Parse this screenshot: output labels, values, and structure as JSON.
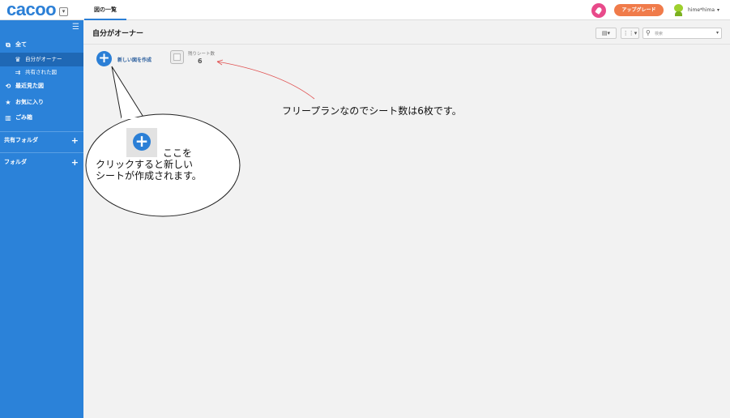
{
  "app": {
    "logo": "cacoo",
    "tab_label": "図の一覧",
    "upgrade_label": "アップグレード",
    "username": "hime*hima",
    "user_caret": "▾"
  },
  "sidebar": {
    "items": [
      {
        "label": "全て",
        "icon": "copy-icon",
        "glyph": "⧉"
      },
      {
        "label": "自分がオーナー",
        "icon": "crown-icon",
        "glyph": "♛"
      },
      {
        "label": "共有された図",
        "icon": "shared-user-icon",
        "glyph": "⇉"
      },
      {
        "label": "最近見た図",
        "icon": "history-icon",
        "glyph": "⟲"
      },
      {
        "label": "お気に入り",
        "icon": "star-icon",
        "glyph": "★"
      },
      {
        "label": "ごみ箱",
        "icon": "trash-icon",
        "glyph": "🗑"
      }
    ],
    "shared_folders_label": "共有フォルダ",
    "folders_label": "フォルダ"
  },
  "main": {
    "title": "自分がオーナー",
    "search_placeholder": "検索",
    "new_diagram_label": "新しい図を作成",
    "remaining_sheets_label": "残りシート数",
    "remaining_sheets_count": "6"
  },
  "annotation": {
    "note": "フリープランなのでシート数は6枚です。",
    "bubble_line1": "ここを",
    "bubble_line2": "クリックすると新しい",
    "bubble_line3": "シートが作成されます。"
  },
  "colors": {
    "sidebar": "#2b82d9",
    "accent": "#2b7fd6",
    "upgrade": "#f07b4a",
    "rocket": "#e84a8a",
    "arrow": "#e05050"
  }
}
